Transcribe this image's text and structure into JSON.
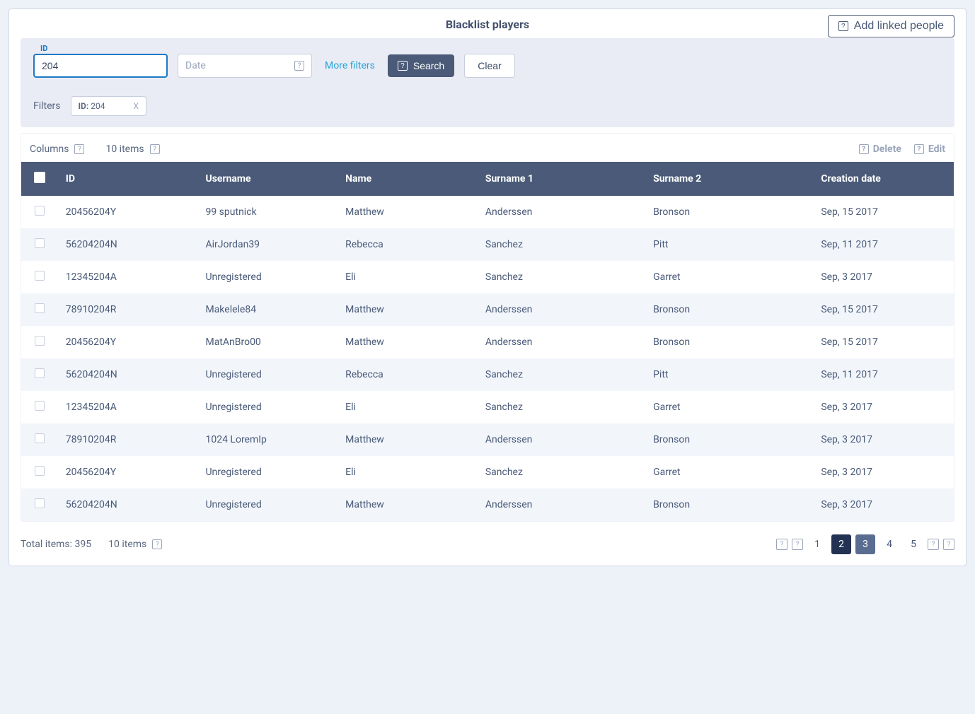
{
  "header": {
    "title": "Blacklist players",
    "add_button": "Add linked people"
  },
  "filters": {
    "id_label": "ID",
    "id_value": "204",
    "date_placeholder": "Date",
    "more_filters": "More filters",
    "search": "Search",
    "clear": "Clear",
    "applied_label": "Filters",
    "chip_key": "ID:",
    "chip_val": "204",
    "chip_close": "X"
  },
  "toolbar": {
    "columns": "Columns",
    "items": "10 items",
    "delete": "Delete",
    "edit": "Edit"
  },
  "table": {
    "headers": {
      "id": "ID",
      "username": "Username",
      "name": "Name",
      "surname1": "Surname 1",
      "surname2": "Surname 2",
      "date": "Creation date"
    },
    "rows": [
      {
        "id": "20456204Y",
        "username": "99 sputnick",
        "name": "Matthew",
        "s1": "Anderssen",
        "s2": "Bronson",
        "date": "Sep, 15 2017"
      },
      {
        "id": "56204204N",
        "username": "AirJordan39",
        "name": "Rebecca",
        "s1": "Sanchez",
        "s2": "Pitt",
        "date": "Sep, 11 2017"
      },
      {
        "id": "12345204A",
        "username": "Unregistered",
        "name": "Eli",
        "s1": "Sanchez",
        "s2": "Garret",
        "date": "Sep, 3 2017"
      },
      {
        "id": "78910204R",
        "username": "Makelele84",
        "name": "Matthew",
        "s1": "Anderssen",
        "s2": "Bronson",
        "date": "Sep, 15 2017"
      },
      {
        "id": "20456204Y",
        "username": "MatAnBro00",
        "name": "Matthew",
        "s1": "Anderssen",
        "s2": "Bronson",
        "date": "Sep, 15 2017"
      },
      {
        "id": "56204204N",
        "username": "Unregistered",
        "name": "Rebecca",
        "s1": "Sanchez",
        "s2": "Pitt",
        "date": "Sep, 11 2017"
      },
      {
        "id": "12345204A",
        "username": "Unregistered",
        "name": "Eli",
        "s1": "Sanchez",
        "s2": "Garret",
        "date": "Sep, 3 2017"
      },
      {
        "id": "78910204R",
        "username": "1024 LoremIp",
        "name": "Matthew",
        "s1": "Anderssen",
        "s2": "Bronson",
        "date": "Sep, 3 2017"
      },
      {
        "id": "20456204Y",
        "username": "Unregistered",
        "name": "Eli",
        "s1": "Sanchez",
        "s2": "Garret",
        "date": "Sep, 3 2017"
      },
      {
        "id": "56204204N",
        "username": "Unregistered",
        "name": "Matthew",
        "s1": "Anderssen",
        "s2": "Bronson",
        "date": "Sep, 3 2017"
      }
    ]
  },
  "footer": {
    "total": "Total items: 395",
    "page_size": "10 items",
    "pages": [
      "1",
      "2",
      "3",
      "4",
      "5"
    ]
  }
}
